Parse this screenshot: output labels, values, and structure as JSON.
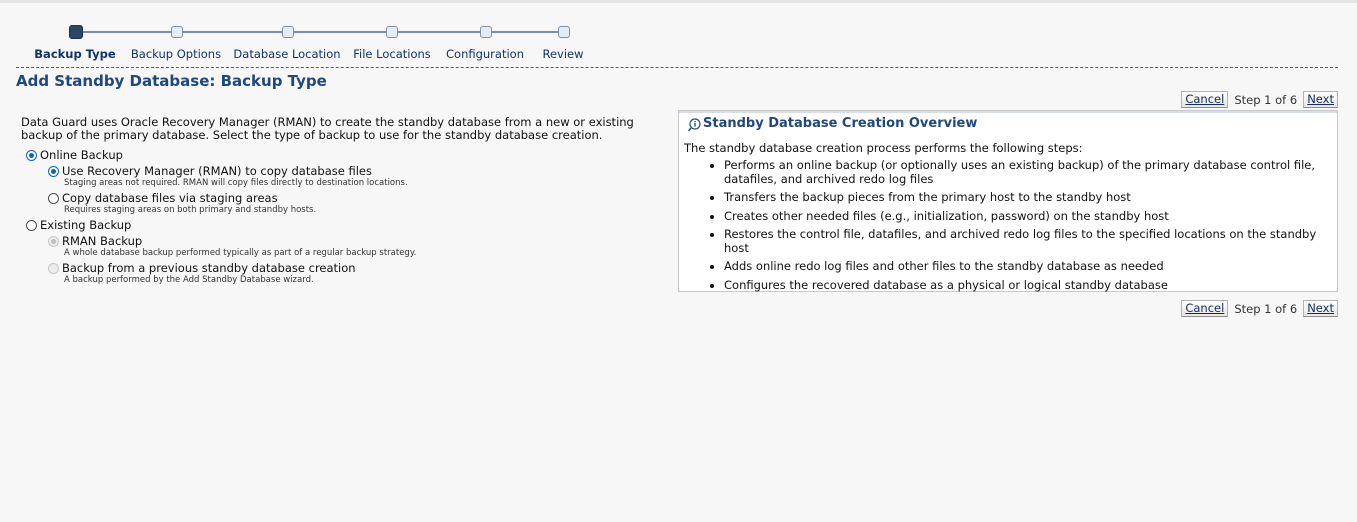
{
  "train": {
    "steps": [
      {
        "label": "Backup Type",
        "active": true
      },
      {
        "label": "Backup Options",
        "active": false
      },
      {
        "label": "Database Location",
        "active": false
      },
      {
        "label": "File Locations",
        "active": false
      },
      {
        "label": "Configuration",
        "active": false
      },
      {
        "label": "Review",
        "active": false
      }
    ]
  },
  "page": {
    "title": "Add Standby Database: Backup Type",
    "intro": "Data Guard uses Oracle Recovery Manager (RMAN) to create the standby database from a new or existing backup of the primary database. Select the type of backup to use for the standby database creation."
  },
  "nav": {
    "cancel_label": "Cancel",
    "step_text": "Step 1 of 6",
    "next_label": "Next"
  },
  "options": {
    "online_backup": {
      "label": "Online Backup",
      "checked": true
    },
    "use_rman": {
      "label": "Use Recovery Manager (RMAN) to copy database files",
      "hint": "Staging areas not required. RMAN will copy files directly to destination locations.",
      "checked": true
    },
    "staging": {
      "label": "Copy database files via staging areas",
      "hint": "Requires staging areas on both primary and standby hosts.",
      "checked": false
    },
    "existing_backup": {
      "label": "Existing Backup",
      "checked": false
    },
    "rman_backup": {
      "label": "RMAN Backup",
      "hint": "A whole database backup performed typically as part of a regular backup strategy.",
      "checked": true,
      "disabled": true
    },
    "previous_standby": {
      "label": "Backup from a previous standby database creation",
      "hint": "A backup performed by the Add Standby Database wizard.",
      "checked": false,
      "disabled": true
    }
  },
  "overview": {
    "icon": "info-icon",
    "title": "Standby Database Creation Overview",
    "intro": "The standby database creation process performs the following steps:",
    "items": [
      "Performs an online backup (or optionally uses an existing backup) of the primary database control file, datafiles, and archived redo log files",
      "Transfers the backup pieces from the primary host to the standby host",
      "Creates other needed files (e.g., initialization, password) on the standby host",
      "Restores the control file, datafiles, and archived redo log files to the specified locations on the standby host",
      "Adds online redo log files and other files to the standby database as needed",
      "Configures the recovered database as a physical or logical standby database"
    ]
  },
  "colors": {
    "title_blue": "#1f4780",
    "link_blue": "#12326b",
    "radio_blue": "#0a63c9"
  }
}
